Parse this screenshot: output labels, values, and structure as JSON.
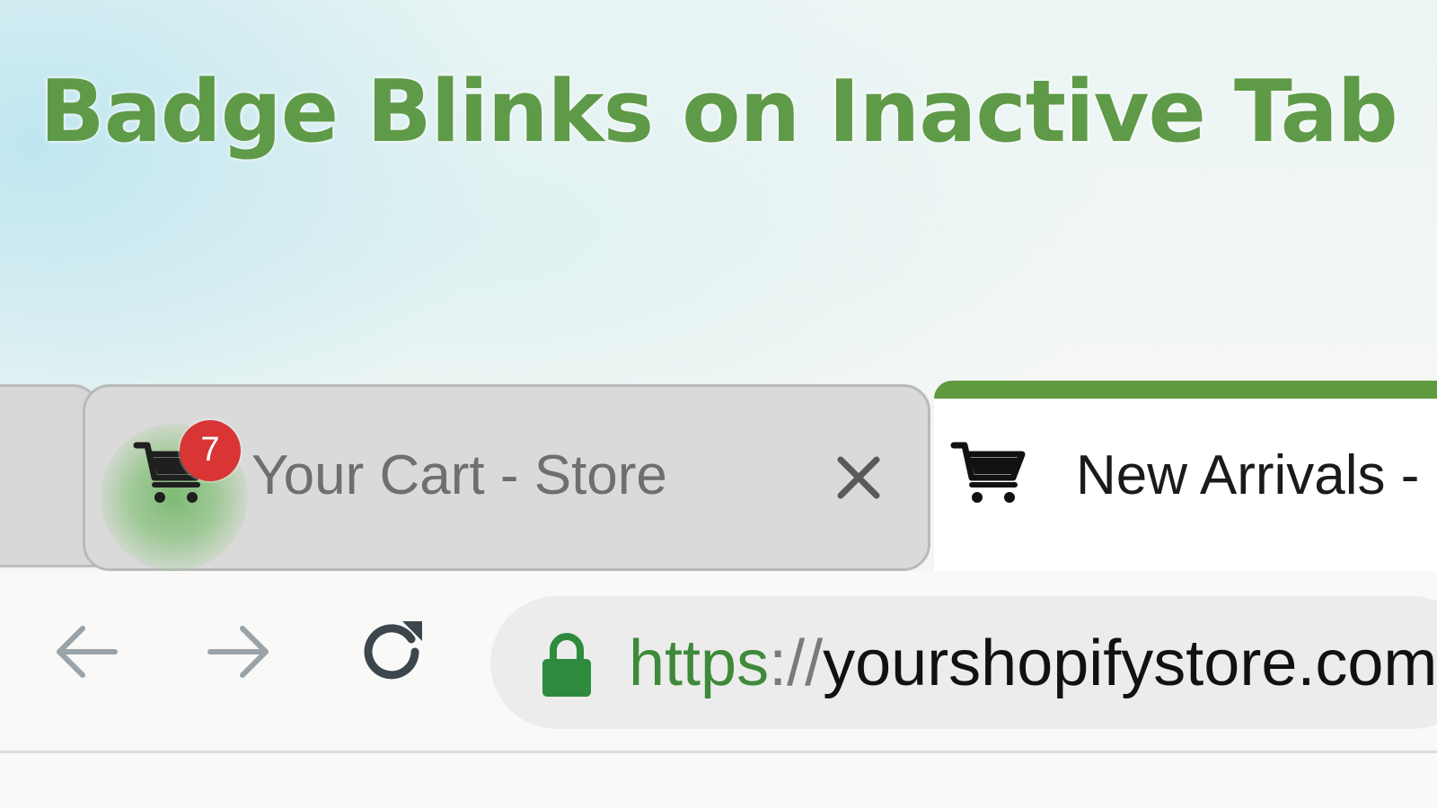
{
  "headline": "Badge Blinks on Inactive Tab",
  "tabs": [
    {
      "title": "Your Cart - Store",
      "icon": "shopping-cart-icon",
      "badge_count": "7",
      "state": "inactive",
      "close_icon": "close-icon"
    },
    {
      "title": "New Arrivals -",
      "icon": "shopping-cart-icon",
      "state": "active"
    }
  ],
  "toolbar": {
    "back_icon": "arrow-left-icon",
    "forward_icon": "arrow-right-icon",
    "reload_icon": "reload-icon"
  },
  "address_bar": {
    "lock_icon": "lock-icon",
    "url_scheme": "https",
    "url_separator": "://",
    "url_host": "yourshopifystore.com"
  },
  "colors": {
    "headline_green": "#5f9a48",
    "active_tab_accent": "#5f9a3e",
    "badge_red": "#d93535",
    "lock_green": "#2e8b3e",
    "glow_green": "#60b050"
  }
}
